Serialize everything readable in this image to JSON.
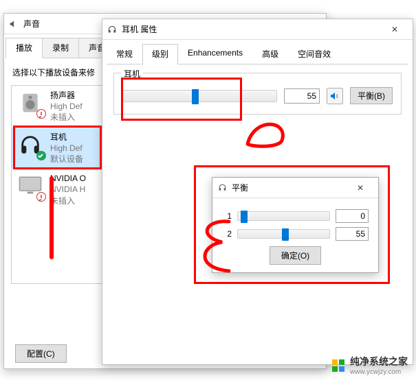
{
  "sound_window": {
    "title": "声音",
    "tabs": [
      "播放",
      "录制",
      "声音"
    ],
    "active_tab": 0,
    "instruction": "选择以下播放设备来修",
    "devices": [
      {
        "name": "扬声器",
        "sub1": "High Def",
        "sub2": "未插入",
        "icon": "speaker",
        "status": "unplugged"
      },
      {
        "name": "耳机",
        "sub1": "High Def",
        "sub2": "默认设备",
        "icon": "headphones",
        "status": "default",
        "selected": true
      },
      {
        "name": "NVIDIA O",
        "sub1": "NVIDIA H",
        "sub2": "未插入",
        "icon": "monitor",
        "status": "unplugged"
      }
    ],
    "configure_btn": "配置(C)"
  },
  "props_window": {
    "title": "耳机 属性",
    "tabs": [
      "常规",
      "级别",
      "Enhancements",
      "高级",
      "空间音效"
    ],
    "active_tab": 1,
    "group_label": "耳机",
    "volume_value": "55",
    "balance_btn": "平衡(B)"
  },
  "balance_dialog": {
    "title": "平衡",
    "rows": [
      {
        "label": "1",
        "value": "0",
        "pos": 8
      },
      {
        "label": "2",
        "value": "55",
        "pos": 55
      }
    ],
    "ok_btn": "确定(O)"
  },
  "watermark": {
    "main": "纯净系统之家",
    "sub": "www.ycwjzy.com"
  }
}
